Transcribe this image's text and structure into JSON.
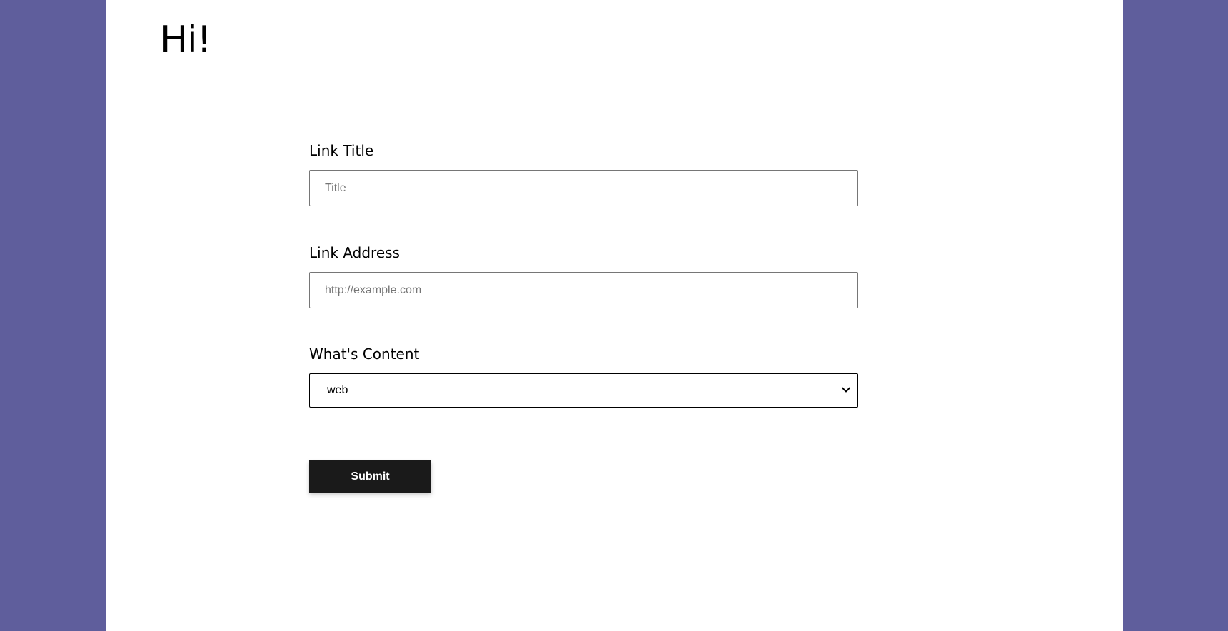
{
  "header": {
    "greeting": "Hi!"
  },
  "form": {
    "title_field": {
      "label": "Link Title",
      "placeholder": "Title",
      "value": ""
    },
    "address_field": {
      "label": "Link Address",
      "placeholder": "http://example.com",
      "value": ""
    },
    "content_field": {
      "label": "What's Content",
      "selected": "web"
    },
    "submit_label": "Submit"
  },
  "colors": {
    "background": "#5f5e9c",
    "page": "#ffffff",
    "button": "#1a1a1a"
  },
  "icons": {
    "select_arrow": "chevron-down-icon"
  }
}
